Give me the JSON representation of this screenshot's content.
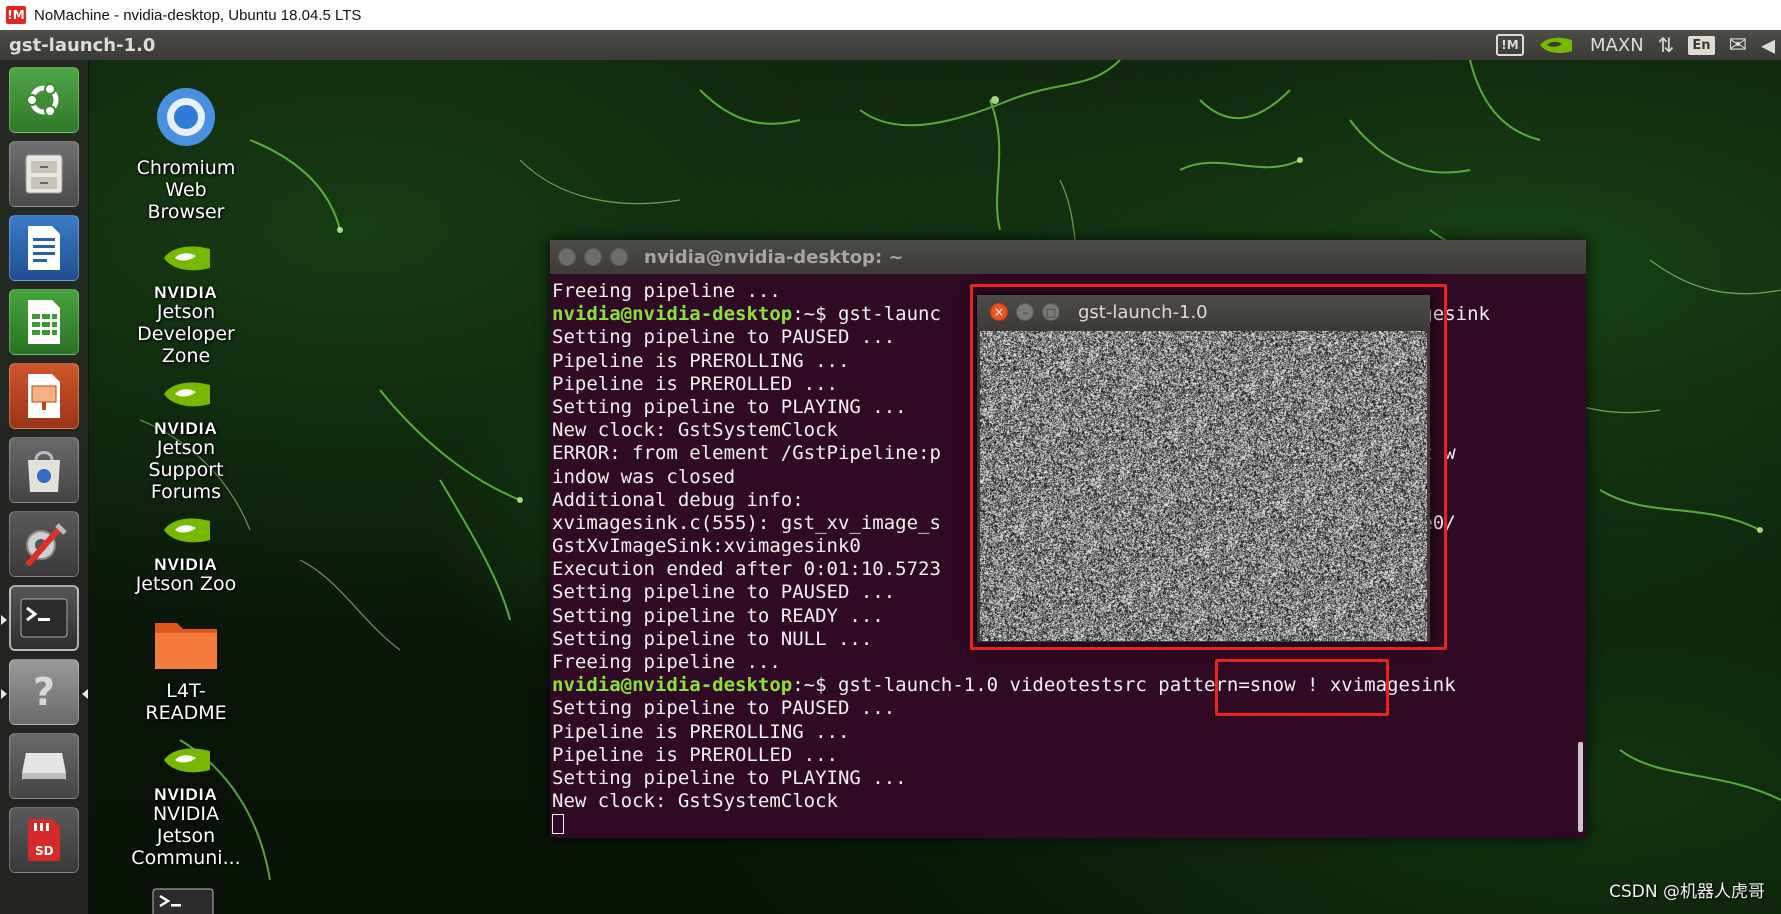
{
  "window": {
    "app_logo_text": "!M",
    "title": "NoMachine - nvidia-desktop, Ubuntu 18.04.5 LTS"
  },
  "top_panel": {
    "active_app": "gst-launch-1.0",
    "tray": {
      "nomachine_icon": "nomachine-icon",
      "nvidia_icon": "nvidia-icon",
      "power_mode": "MAXN",
      "network_icon": "network-arrows-icon",
      "keyboard_layout": "En",
      "mail_icon": "mail-icon",
      "volume_icon": "volume-icon"
    }
  },
  "launcher": {
    "items": [
      {
        "name": "ubuntu-dash",
        "icon": "ubuntu-icon"
      },
      {
        "name": "files",
        "icon": "file-cabinet-icon"
      },
      {
        "name": "libreoffice-writer",
        "icon": "writer-icon"
      },
      {
        "name": "libreoffice-calc",
        "icon": "calc-icon"
      },
      {
        "name": "libreoffice-impress",
        "icon": "impress-icon"
      },
      {
        "name": "software-center",
        "icon": "shopping-bag-icon"
      },
      {
        "name": "system-settings",
        "icon": "settings-tools-icon"
      },
      {
        "name": "terminal",
        "icon": "terminal-icon"
      },
      {
        "name": "help",
        "icon": "question-mark-icon"
      },
      {
        "name": "disk-drive",
        "icon": "drive-icon"
      },
      {
        "name": "sd-card",
        "icon": "sd-card-icon"
      }
    ]
  },
  "desktop_icons": [
    {
      "label": "Chromium Web Browser",
      "lines": [
        "Chromium",
        "Web",
        "Browser"
      ]
    },
    {
      "label": "Jetson Developer Zone",
      "lines": [
        "Jetson",
        "Developer",
        "Zone"
      ]
    },
    {
      "label": "Jetson Support Forums",
      "lines": [
        "Jetson",
        "Support",
        "Forums"
      ]
    },
    {
      "label": "Jetson Zoo",
      "lines": [
        "Jetson Zoo"
      ]
    },
    {
      "label": "L4T-README",
      "lines": [
        "L4T-",
        "README"
      ]
    },
    {
      "label": "NVIDIA Jetson Communi...",
      "lines": [
        "NVIDIA",
        "Jetson",
        "Communi..."
      ]
    }
  ],
  "nvidia_word": "NVIDIA",
  "terminal": {
    "title": "nvidia@nvidia-desktop: ~",
    "lines": [
      {
        "prompt": "",
        "text": "Freeing pipeline ..."
      },
      {
        "prompt": "nvidia@nvidia-desktop",
        "text": ":~$ gst-launc                                     xvimagesink"
      },
      {
        "prompt": "",
        "text": "Setting pipeline to PAUSED ..."
      },
      {
        "prompt": "",
        "text": "Pipeline is PREROLLING ..."
      },
      {
        "prompt": "",
        "text": "Pipeline is PREROLLED ..."
      },
      {
        "prompt": "",
        "text": "Setting pipeline to PLAYING ..."
      },
      {
        "prompt": "",
        "text": "New clock: GstSystemClock"
      },
      {
        "prompt": "",
        "text": "ERROR: from element /GstPipeline:p                                  0: Output w"
      },
      {
        "prompt": "",
        "text": "indow was closed"
      },
      {
        "prompt": "",
        "text": "Additional debug info:"
      },
      {
        "prompt": "",
        "text": "xvimagesink.c(555): gst_xv_image_s                                  :pipeline0/"
      },
      {
        "prompt": "",
        "text": "GstXvImageSink:xvimagesink0"
      },
      {
        "prompt": "",
        "text": "Execution ended after 0:01:10.5723"
      },
      {
        "prompt": "",
        "text": "Setting pipeline to PAUSED ..."
      },
      {
        "prompt": "",
        "text": "Setting pipeline to READY ..."
      },
      {
        "prompt": "",
        "text": "Setting pipeline to NULL ..."
      },
      {
        "prompt": "",
        "text": "Freeing pipeline ..."
      },
      {
        "prompt": "nvidia@nvidia-desktop",
        "text": ":~$ gst-launch-1.0 videotestsrc pattern=snow ! xvimagesink"
      },
      {
        "prompt": "",
        "text": "Setting pipeline to PAUSED ..."
      },
      {
        "prompt": "",
        "text": "Pipeline is PREROLLING ..."
      },
      {
        "prompt": "",
        "text": "Pipeline is PREROLLED ..."
      },
      {
        "prompt": "",
        "text": "Setting pipeline to PLAYING ..."
      },
      {
        "prompt": "",
        "text": "New clock: GstSystemClock"
      }
    ]
  },
  "gst_window": {
    "title": "gst-launch-1.0",
    "content": "snow-noise-video"
  },
  "annotations": {
    "color": "#e8241c",
    "boxes": [
      "gst-window-highlight",
      "pattern-snow-highlight"
    ]
  },
  "watermark": "CSDN @机器人虎哥"
}
